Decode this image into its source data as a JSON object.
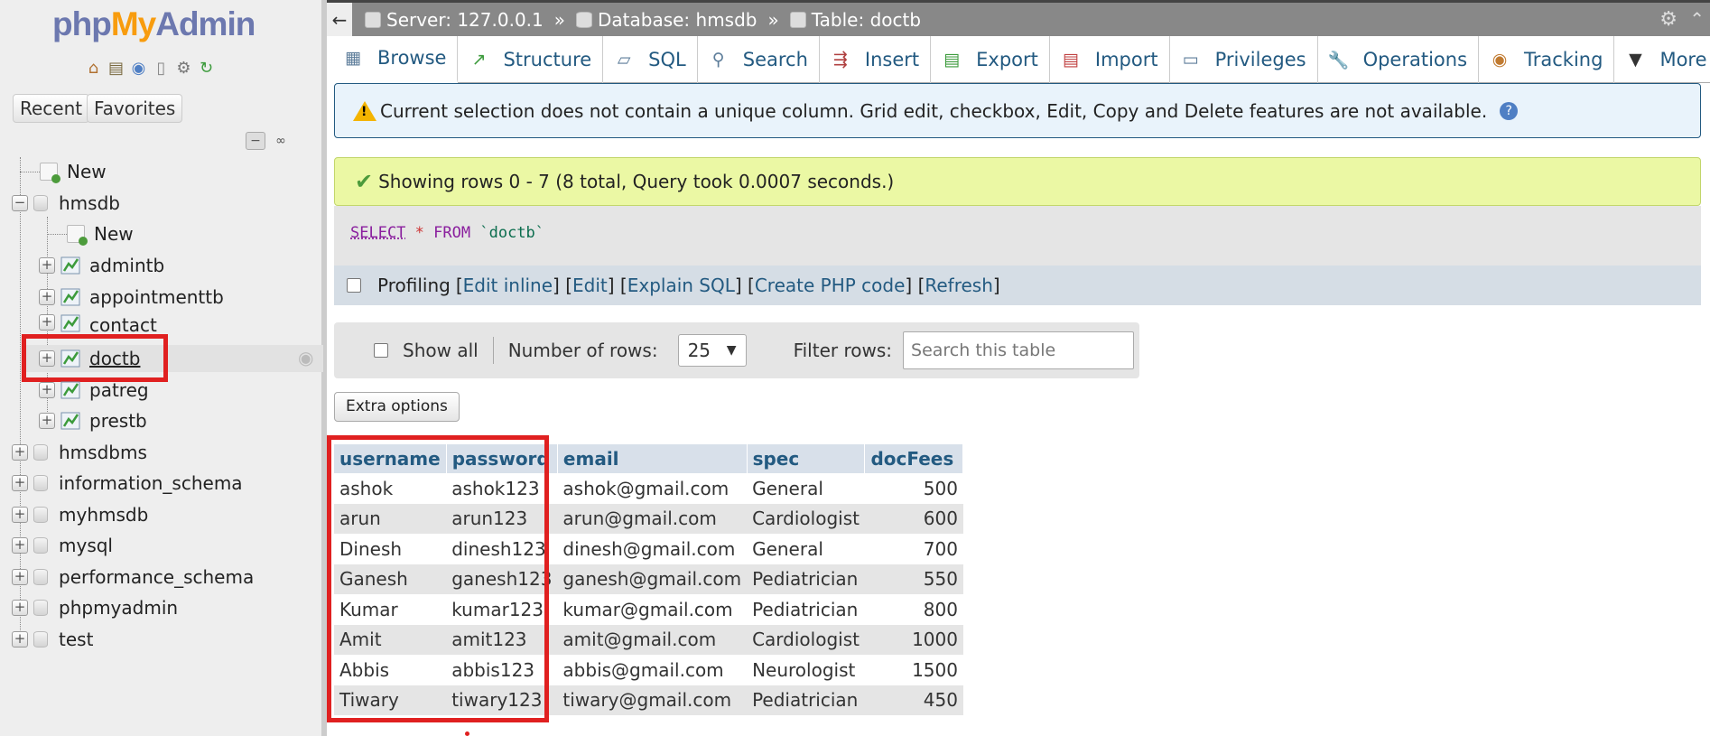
{
  "sidebar": {
    "logo": {
      "php": "php",
      "my": "My",
      "admin": "Admin"
    },
    "tabs": {
      "recent": "Recent",
      "favorites": "Favorites"
    },
    "tree": {
      "new_root": "New",
      "hmsdb": "hmsdb",
      "hmsdb_children": {
        "new": "New",
        "tables": [
          "admintb",
          "appointmenttb",
          "contact",
          "doctb",
          "patreg",
          "prestb"
        ]
      },
      "other_dbs": [
        "hmsdbms",
        "information_schema",
        "myhmsdb",
        "mysql",
        "performance_schema",
        "phpmyadmin",
        "test"
      ]
    }
  },
  "topbar": {
    "back": "←",
    "server": "Server: 127.0.0.1",
    "database": "Database: hmsdb",
    "table": "Table: doctb",
    "separator": "»"
  },
  "tabs": [
    "Browse",
    "Structure",
    "SQL",
    "Search",
    "Insert",
    "Export",
    "Import",
    "Privileges",
    "Operations",
    "Tracking",
    "More"
  ],
  "notice": {
    "text": "Current selection does not contain a unique column. Grid edit, checkbox, Edit, Copy and Delete features are not available.",
    "help": "?"
  },
  "success": {
    "text": "Showing rows 0 - 7 (8 total, Query took 0.0007 seconds.)"
  },
  "sql": {
    "select": "SELECT",
    "star": "*",
    "from": "FROM",
    "table": "`doctb`"
  },
  "profiling": {
    "label": "Profiling",
    "links": [
      "Edit inline",
      "Edit",
      "Explain SQL",
      "Create PHP code",
      "Refresh"
    ]
  },
  "controls": {
    "show_all": "Show all",
    "rows_label": "Number of rows:",
    "rows_value": "25",
    "filter_label": "Filter rows:",
    "filter_placeholder": "Search this table"
  },
  "extra_options": "Extra options",
  "table": {
    "columns": [
      "username",
      "password",
      "email",
      "spec",
      "docFees"
    ],
    "rows": [
      [
        "ashok",
        "ashok123",
        "ashok@gmail.com",
        "General",
        "500"
      ],
      [
        "arun",
        "arun123",
        "arun@gmail.com",
        "Cardiologist",
        "600"
      ],
      [
        "Dinesh",
        "dinesh123",
        "dinesh@gmail.com",
        "General",
        "700"
      ],
      [
        "Ganesh",
        "ganesh123",
        "ganesh@gmail.com",
        "Pediatrician",
        "550"
      ],
      [
        "Kumar",
        "kumar123",
        "kumar@gmail.com",
        "Pediatrician",
        "800"
      ],
      [
        "Amit",
        "amit123",
        "amit@gmail.com",
        "Cardiologist",
        "1000"
      ],
      [
        "Abbis",
        "abbis123",
        "abbis@gmail.com",
        "Neurologist",
        "1500"
      ],
      [
        "Tiwary",
        "tiwary123",
        "tiwary@gmail.com",
        "Pediatrician",
        "450"
      ]
    ]
  },
  "colors": {
    "link": "#235a81",
    "highlight": "#e02020",
    "success_bg": "#ebf8a4"
  }
}
